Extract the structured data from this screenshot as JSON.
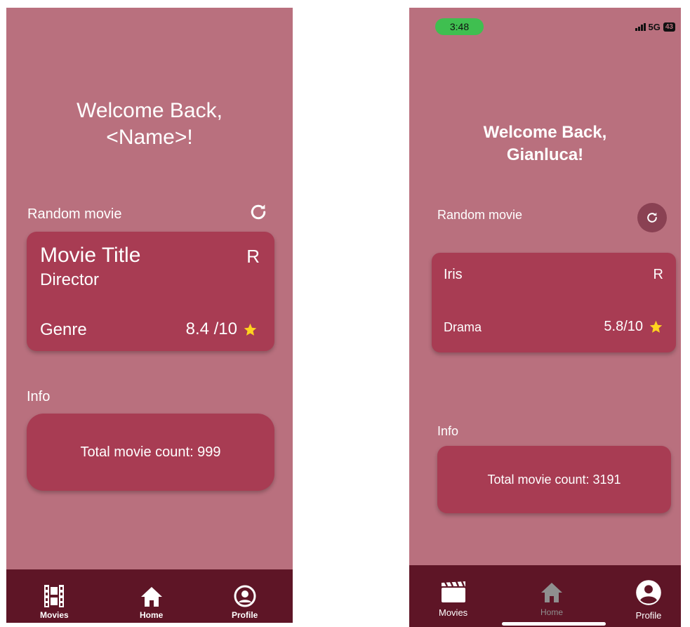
{
  "left": {
    "welcome_line1": "Welcome Back,",
    "welcome_line2": "<Name>!",
    "random_label": "Random movie",
    "movie": {
      "title": "Movie Title",
      "director": "Director",
      "rating": "R",
      "genre": "Genre",
      "score": "8.4 /10"
    },
    "info_label": "Info",
    "total_count": "Total movie count: 999",
    "nav": {
      "movies": "Movies",
      "home": "Home",
      "profile": "Profile"
    }
  },
  "right": {
    "status": {
      "time": "3:48",
      "network": "5G",
      "battery": "43"
    },
    "welcome_line1": "Welcome Back,",
    "welcome_line2": "Gianluca!",
    "random_label": "Random movie",
    "movie": {
      "title": "Iris",
      "rating": "R",
      "genre": "Drama",
      "score": "5.8/10"
    },
    "info_label": "Info",
    "total_count": "Total movie count: 3191",
    "nav": {
      "movies": "Movies",
      "home": "Home",
      "profile": "Profile"
    }
  },
  "colors": {
    "background": "#b9707e",
    "card": "#a83c53",
    "navbar": "#5e1526",
    "star": "#ffd21f",
    "status_pill": "#3fbf50"
  },
  "icons": {
    "refresh": "refresh-icon",
    "star": "star-icon",
    "movies": "film-icon",
    "home": "home-icon",
    "profile": "profile-icon"
  }
}
